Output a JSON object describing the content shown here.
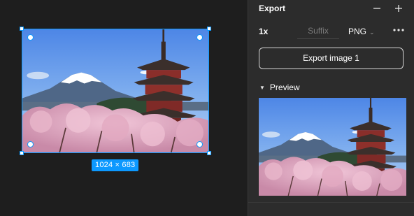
{
  "canvas": {
    "image_dimensions": "1024 × 683",
    "image_description_icon": "photo-fuji-pagoda"
  },
  "panel": {
    "title": "Export",
    "remove_icon": "minus-icon",
    "add_icon": "plus-icon",
    "scale": "1x",
    "suffix_placeholder": "Suffix",
    "format": "PNG",
    "more_icon": "ellipsis-icon",
    "export_button": "Export image 1",
    "preview_label": "Preview"
  },
  "colors": {
    "selection": "#0d99ff",
    "panel_bg": "#2c2c2c",
    "canvas_bg": "#1e1e1e"
  }
}
